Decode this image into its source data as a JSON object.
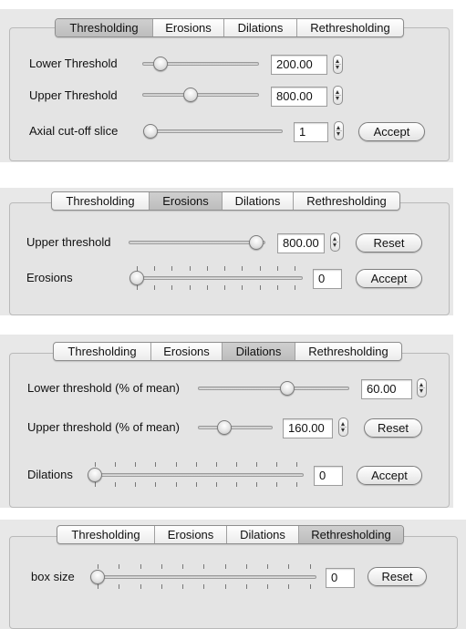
{
  "panels": [
    {
      "tabs": [
        "Thresholding",
        "Erosions",
        "Dilations",
        "Rethresholding"
      ],
      "selected_tab": "Thresholding",
      "rows": [
        {
          "label": "Lower Threshold",
          "value": "200.00"
        },
        {
          "label": "Upper Threshold",
          "value": "800.00"
        },
        {
          "label": "Axial cut-off slice",
          "value": "1",
          "button": "Accept"
        }
      ]
    },
    {
      "tabs": [
        "Thresholding",
        "Erosions",
        "Dilations",
        "Rethresholding"
      ],
      "selected_tab": "Erosions",
      "rows": [
        {
          "label": "Upper threshold",
          "value": "800.00",
          "button": "Reset"
        },
        {
          "label": "Erosions",
          "value": "0",
          "button": "Accept"
        }
      ]
    },
    {
      "tabs": [
        "Thresholding",
        "Erosions",
        "Dilations",
        "Rethresholding"
      ],
      "selected_tab": "Dilations",
      "rows": [
        {
          "label": "Lower threshold (% of mean)",
          "value": "60.00"
        },
        {
          "label": "Upper threshold (% of mean)",
          "value": "160.00",
          "button": "Reset"
        },
        {
          "label": "Dilations",
          "value": "0",
          "button": "Accept"
        }
      ]
    },
    {
      "tabs": [
        "Thresholding",
        "Erosions",
        "Dilations",
        "Rethresholding"
      ],
      "selected_tab": "Rethresholding",
      "rows": [
        {
          "label": "box size",
          "value": "0",
          "button": "Reset"
        }
      ]
    }
  ]
}
